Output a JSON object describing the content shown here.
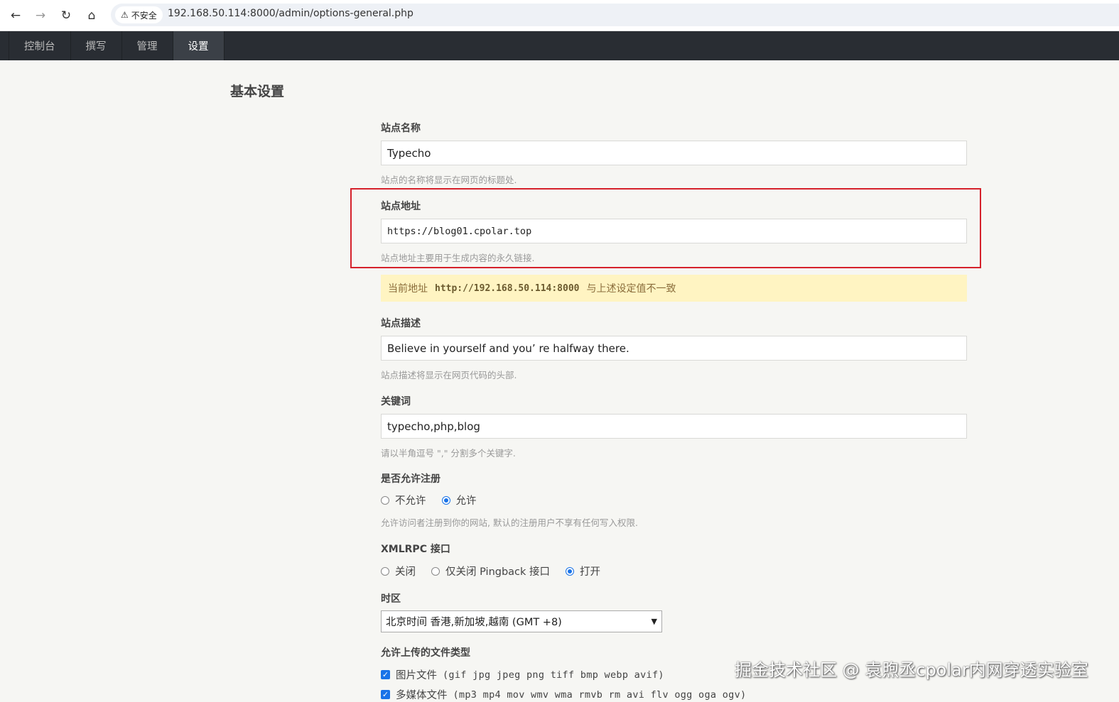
{
  "browser": {
    "security_label": "不安全",
    "url": "192.168.50.114:8000/admin/options-general.php"
  },
  "admin_nav": {
    "items": [
      {
        "label": "控制台",
        "active": false
      },
      {
        "label": "撰写",
        "active": false
      },
      {
        "label": "管理",
        "active": false
      },
      {
        "label": "设置",
        "active": true
      }
    ]
  },
  "page": {
    "title": "基本设置"
  },
  "form": {
    "site_name": {
      "label": "站点名称",
      "value": "Typecho",
      "desc": "站点的名称将显示在网页的标题处."
    },
    "site_url": {
      "label": "站点地址",
      "value": "https://blog01.cpolar.top",
      "desc": "站点地址主要用于生成内容的永久链接."
    },
    "notice": {
      "prefix": "当前地址",
      "url": "http://192.168.50.114:8000",
      "suffix": "与上述设定值不一致"
    },
    "site_desc": {
      "label": "站点描述",
      "value": "Believe in yourself and you’  re halfway there.",
      "desc": "站点描述将显示在网页代码的头部."
    },
    "keywords": {
      "label": "关键词",
      "value": "typecho,php,blog",
      "desc": "请以半角逗号 \",\" 分割多个关键字."
    },
    "allow_register": {
      "label": "是否允许注册",
      "options": [
        {
          "label": "不允许",
          "checked": false
        },
        {
          "label": "允许",
          "checked": true
        }
      ],
      "desc": "允许访问者注册到你的网站, 默认的注册用户不享有任何写入权限."
    },
    "xmlrpc": {
      "label": "XMLRPC 接口",
      "options": [
        {
          "label": "关闭",
          "checked": false
        },
        {
          "label": "仅关闭 Pingback 接口",
          "checked": false
        },
        {
          "label": "打开",
          "checked": true
        }
      ]
    },
    "timezone": {
      "label": "时区",
      "value": "北京时间 香港,新加坡,越南 (GMT +8)"
    },
    "upload_types": {
      "label": "允许上传的文件类型",
      "options": [
        {
          "name": "图片文件",
          "ext": "(gif jpg jpeg png tiff bmp webp avif)",
          "checked": true
        },
        {
          "name": "多媒体文件",
          "ext": "(mp3 mp4 mov wmv wma rmvb rm avi flv ogg oga ogv)",
          "checked": true
        }
      ]
    }
  },
  "watermark": "掘金技术社区 @ 袁煦丞cpolar内网穿透实验室"
}
